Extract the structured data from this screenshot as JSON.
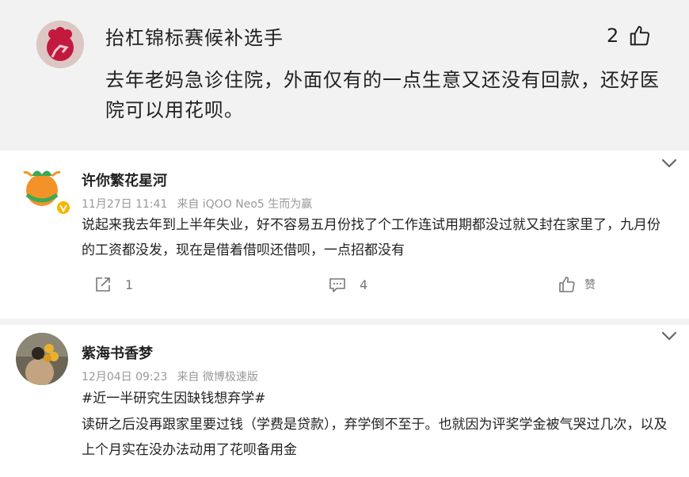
{
  "top_reply": {
    "username": "抬杠锦标赛候补选手",
    "like_count": "2",
    "text": "去年老妈急诊住院，外面仅有的一点生意又还没有回款，还好医院可以用花呗。"
  },
  "comments": [
    {
      "username": "许你繁花星河",
      "date": "11月27日 11:41",
      "source": "来自 iQOO Neo5 生而为赢",
      "text": "说起来我去年到上半年失业，好不容易五月份找了个工作连试用期都没过就又封在家里了，九月份的工资都没发，现在是借着借呗还借呗，一点招都没有",
      "repost_count": "1",
      "comment_count": "4",
      "like_label": "赞"
    },
    {
      "username": "紫海书香梦",
      "date": "12月04日 09:23",
      "source": "来自 微博极速版",
      "hashtag": "#近一半研究生因缺钱想弃学#",
      "text": "读研之后没再跟家里要过钱（学费是贷款），弃学倒不至于。也就因为评奖学金被气哭过几次，以及上个月实在没办法动用了花呗备用金"
    }
  ],
  "icons": {
    "like": "thumbs-up-icon",
    "repost": "repost-icon",
    "comment": "comment-icon",
    "expand": "chevron-down-icon",
    "verified": "verified-badge-icon"
  },
  "colors": {
    "page_background": "#f2f2f2",
    "card_background": "#ffffff",
    "meta_text": "#999999",
    "verified_badge": "#f7b500"
  }
}
